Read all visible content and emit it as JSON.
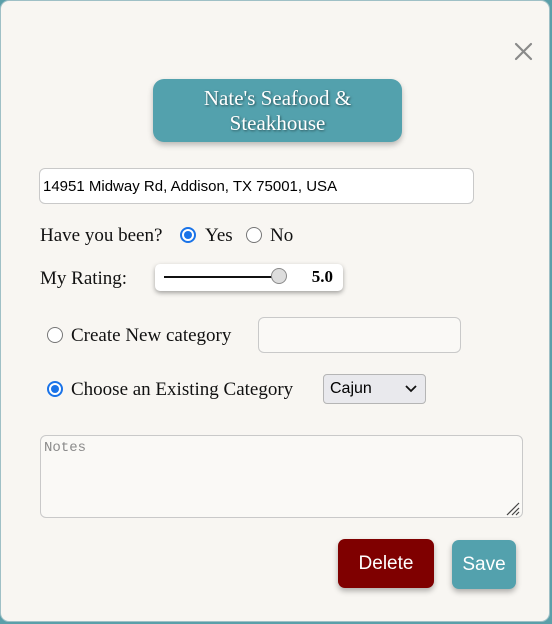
{
  "dialog": {
    "title": "Nate's Seafood & Steakhouse",
    "close_icon": "close-icon"
  },
  "address": {
    "value": "14951 Midway Rd, Addison, TX 75001, USA"
  },
  "visited": {
    "label": "Have you been?",
    "yes_label": "Yes",
    "no_label": "No",
    "selected": "Yes"
  },
  "rating": {
    "label": "My Rating:",
    "value": "5.0",
    "min": 0,
    "max": 5
  },
  "category": {
    "new_label": "Create New category",
    "new_value": "",
    "existing_label": "Choose an Existing Category",
    "selected_option": "Cajun",
    "mode": "existing"
  },
  "notes": {
    "placeholder": "Notes",
    "value": ""
  },
  "buttons": {
    "delete_label": "Delete",
    "save_label": "Save"
  },
  "colors": {
    "accent": "#53a1ad",
    "danger": "#7f0000",
    "radio_selected": "#1a73e8"
  }
}
